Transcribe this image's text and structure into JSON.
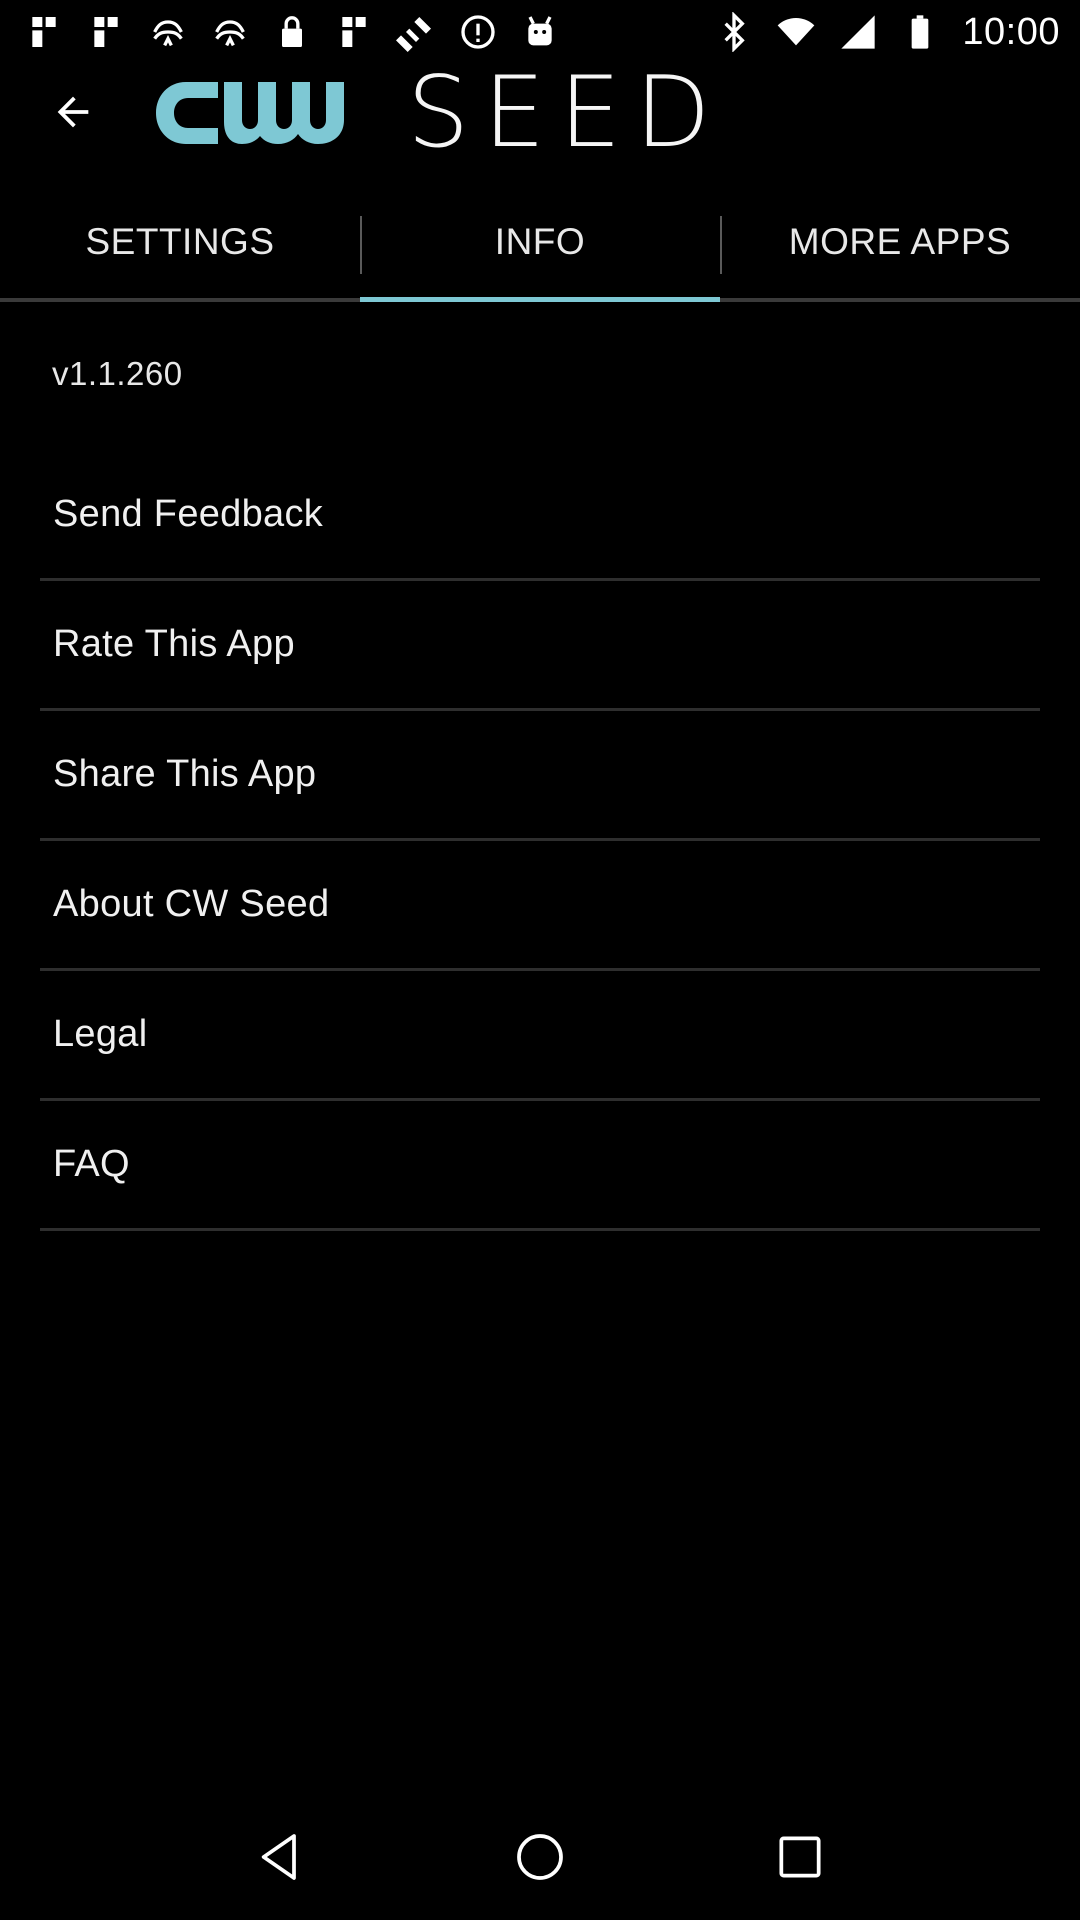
{
  "status_bar": {
    "time": "10:00",
    "left_icons": [
      "notification-a-icon",
      "notification-b-icon",
      "notification-c-icon",
      "notification-d-icon",
      "lock-icon",
      "notification-e-icon",
      "satellite-icon",
      "circle-info-icon",
      "android-icon"
    ],
    "right_icons": [
      "bluetooth-icon",
      "wifi-signal-icon",
      "cell-signal-icon",
      "battery-icon"
    ]
  },
  "app_bar": {
    "back_icon": "back-arrow-icon",
    "logo_text_cw": "cw",
    "logo_text_seed": "SEED",
    "brand_color": "#7ec8d4"
  },
  "tabs": [
    {
      "label": "SETTINGS",
      "active": false
    },
    {
      "label": "INFO",
      "active": true
    },
    {
      "label": "MORE APPS",
      "active": false
    }
  ],
  "info": {
    "version": "v1.1.260",
    "items": [
      {
        "label": "Send Feedback"
      },
      {
        "label": "Rate This App"
      },
      {
        "label": "Share This App"
      },
      {
        "label": "About CW Seed"
      },
      {
        "label": "Legal"
      },
      {
        "label": "FAQ"
      }
    ]
  },
  "nav_bar": {
    "icons": [
      "nav-back-icon",
      "nav-home-icon",
      "nav-recents-icon"
    ]
  },
  "colors": {
    "background": "#000000",
    "accent": "#7ec8d4",
    "divider": "#2e2e2e"
  }
}
